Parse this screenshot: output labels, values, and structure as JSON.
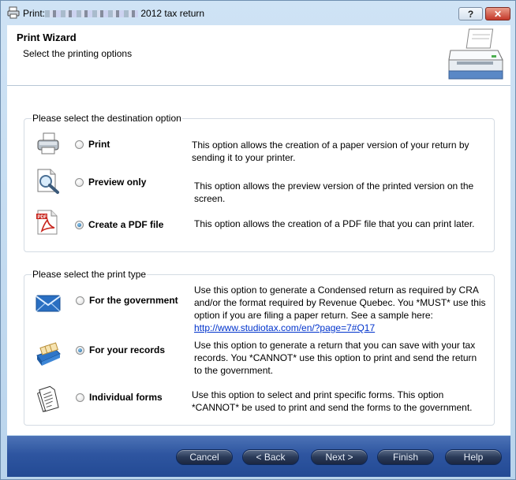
{
  "window": {
    "title_prefix": "Print:",
    "title_suffix": "2012 tax return",
    "help_label": "?",
    "close_label": "✕"
  },
  "header": {
    "title": "Print Wizard",
    "subtitle": "Select the printing options",
    "icon": "printer-icon"
  },
  "destination": {
    "group_title": "Please select the destination option",
    "options": [
      {
        "label": "Print",
        "icon": "printer-icon",
        "selected": false,
        "description": "This option allows the creation of a paper version of your return by sending it to your printer."
      },
      {
        "label": "Preview only",
        "icon": "preview-magnifier-icon",
        "selected": false,
        "description": "This option allows the preview version of the printed version on the screen."
      },
      {
        "label": "Create a PDF file",
        "icon": "pdf-file-icon",
        "selected": true,
        "description": "This option allows the creation of a PDF file that you can print later."
      }
    ]
  },
  "print_type": {
    "group_title": "Please select the print type",
    "options": [
      {
        "label": "For the government",
        "icon": "envelope-icon",
        "selected": false,
        "description": "Use this option to generate a Condensed return as required by CRA and/or the format required by Revenue Quebec. You *MUST* use this option if you are filing a paper return. See a sample here:",
        "link": "http://www.studiotax.com/en/?page=7#Q17"
      },
      {
        "label": "For your records",
        "icon": "card-file-icon",
        "selected": true,
        "description": "Use this option to generate a return that you can save with your tax records. You *CANNOT* use this option to print and send the return to the government."
      },
      {
        "label": "Individual forms",
        "icon": "document-icon",
        "selected": false,
        "description": "Use this option to select and print specific forms. This option *CANNOT* be used to print and send the forms to the government."
      }
    ]
  },
  "footer": {
    "cancel": "Cancel",
    "back": "< Back",
    "next": "Next >",
    "finish": "Finish",
    "help": "Help"
  }
}
